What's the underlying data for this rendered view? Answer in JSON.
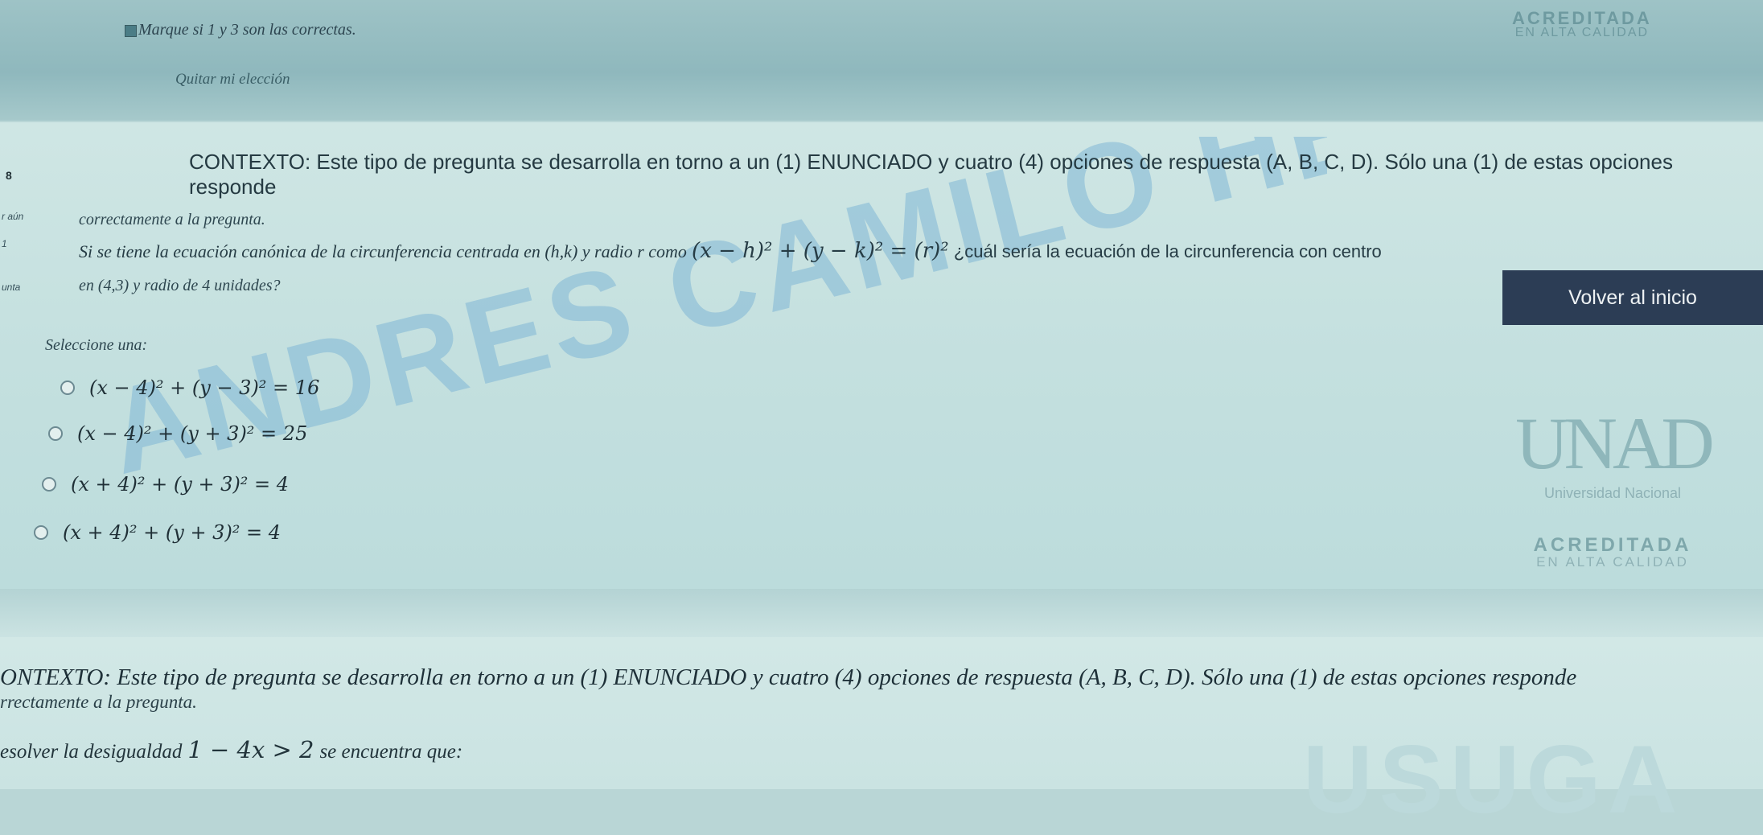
{
  "top": {
    "marque": "Marque si 1 y 3 son las correctas.",
    "quitar": "Quitar mi elección",
    "acreditada": "ACREDITADA",
    "alta_calidad": "EN ALTA CALIDAD"
  },
  "question1": {
    "number": "8",
    "side_labels": [
      "r aún",
      "1",
      "unta"
    ],
    "context": "CONTEXTO: Este tipo de pregunta se desarrolla en torno a un (1) ENUNCIADO y cuatro (4) opciones de respuesta (A, B, C, D). Sólo una (1) de estas opciones responde",
    "context_line2": "correctamente a la pregunta.",
    "statement_a": "Si se tiene la ecuación canónica de la circunferencia centrada en (h,k) y radio r como",
    "statement_math": "(x − h)² + (y − k)² = (r)²",
    "statement_b": "¿cuál sería la ecuación de la circunferencia con centro",
    "statement_line2": "en (4,3) y radio de 4 unidades?",
    "select_label": "Seleccione una:",
    "options": [
      "(x − 4)² + (y − 3)² = 16",
      "(x − 4)² + (y + 3)² = 25",
      "(x + 4)² + (y + 3)² = 4",
      "(x + 4)² + (y + 3)² = 4"
    ]
  },
  "volver": "Volver al inicio",
  "watermark": {
    "line1": "ANDRES CAMILO HERRERA USUGA"
  },
  "unad": {
    "logo": "UNAD",
    "sub": "Universidad Nacional",
    "acreditada": "ACREDITADA",
    "alta_calidad": "EN ALTA CALIDAD"
  },
  "question2": {
    "context": "ONTEXTO: Este tipo de pregunta se desarrolla en torno a un (1) ENUNCIADO y cuatro (4) opciones de respuesta (A, B, C, D). Sólo una (1) de estas opciones responde",
    "context_line2": "rrectamente a la pregunta.",
    "statement_a": "esolver la desigualdad",
    "statement_math": "1 − 4x > 2",
    "statement_b": "se encuentra que:",
    "watermark": "USUGA"
  },
  "colors": {
    "button_bg": "#2c3d55",
    "watermark": "#7fb6d6"
  }
}
